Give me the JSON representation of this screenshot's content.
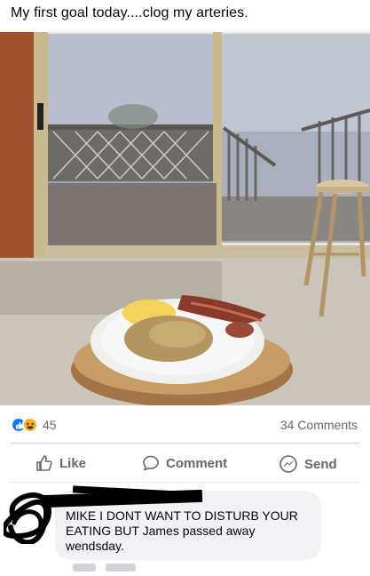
{
  "post": {
    "text": "My first goal today....clog my arteries."
  },
  "photo": {
    "description_icon": "photo-breakfast-plate"
  },
  "reactions": {
    "icons": [
      "like-icon",
      "haha-icon"
    ],
    "count": "45",
    "comments_label": "34 Comments"
  },
  "actions": {
    "like": "Like",
    "comment": "Comment",
    "send": "Send"
  },
  "comment": {
    "text": "MIKE I DONT WANT TO DISTURB YOUR EATING BUT James passed away wendsday."
  },
  "colors": {
    "accent": "#1877f2",
    "muted_text": "#65676b",
    "bubble": "#f0f2f5"
  }
}
